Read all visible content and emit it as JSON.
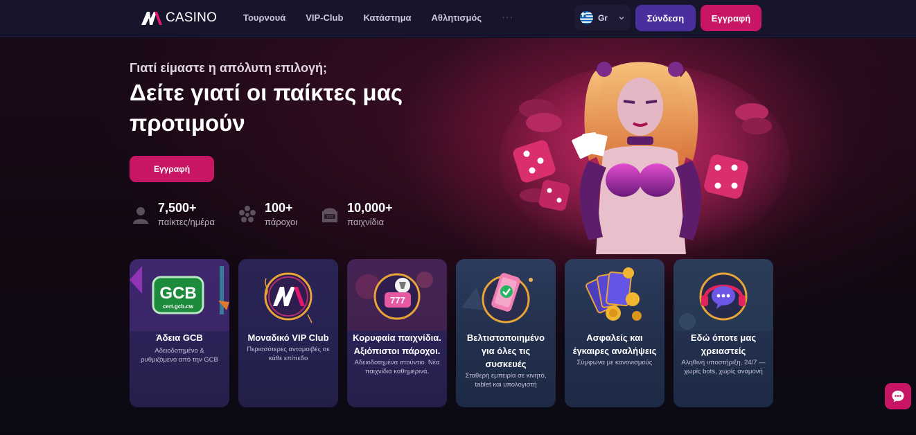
{
  "header": {
    "logo_text": "CASINO",
    "nav": [
      "Τουρνουά",
      "VIP-Club",
      "Κατάστημα",
      "Αθλητισμός"
    ],
    "more": "···",
    "language": "Gr",
    "login": "Σύνδεση",
    "register": "Εγγραφή"
  },
  "hero": {
    "eyebrow": "Γιατί είμαστε η απόλυτη επιλογή;",
    "headline": "Δείτε γιατί οι παίκτες μας προτιμούν",
    "cta": "Εγγραφή",
    "stats": [
      {
        "value": "7,500+",
        "label": "παίκτες/ημέρα"
      },
      {
        "value": "100+",
        "label": "πάροχοι"
      },
      {
        "value": "10,000+",
        "label": "παιχνίδια"
      }
    ]
  },
  "cards": [
    {
      "title": "Άδεια GCB",
      "desc": "Αδειοδοτημένο & ρυθμιζόμενο από την GCB",
      "badge": "GCB",
      "badge_sub": "cert.gcb.cw"
    },
    {
      "title": "Μοναδικό VIP Club",
      "desc": "Περισσότερες ανταμοιβές σε κάθε επίπεδο"
    },
    {
      "title": "Κορυφαία παιχνίδια. Αξιόπιστοι πάροχοι.",
      "desc": "Αδειοδοτημένα στούντιο. Νέα παιχνίδια καθημερινά."
    },
    {
      "title": "Βελτιστοποιημένο για όλες τις συσκευές",
      "desc": "Σταθερή εμπειρία σε κινητό, tablet και υπολογιστή"
    },
    {
      "title": "Ασφαλείς και έγκαιρες αναλήψεις",
      "desc": "Σύμφωνα με κανονισμούς"
    },
    {
      "title": "Εδώ όποτε μας χρειαστείς",
      "desc": "Αληθινή υποστήριξη, 24/7 — χωρίς bots, χωρίς αναμονή"
    }
  ],
  "colors": {
    "accent": "#c81664",
    "login": "#4a2f9c",
    "header_bg": "#17152b"
  }
}
